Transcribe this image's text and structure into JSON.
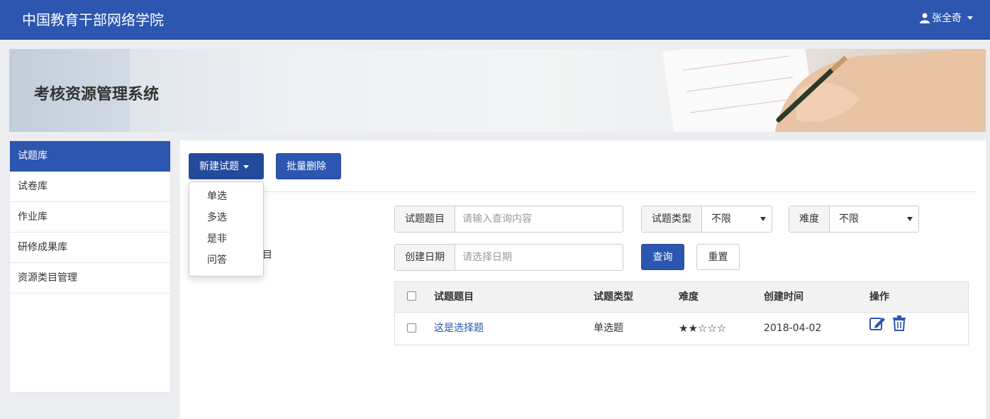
{
  "header": {
    "brand": "中国教育干部网络学院",
    "user_name": "张全奇"
  },
  "banner": {
    "title": "考核资源管理系统"
  },
  "sidebar": {
    "items": [
      {
        "label": "试题库",
        "active": true
      },
      {
        "label": "试卷库"
      },
      {
        "label": "作业库"
      },
      {
        "label": "研修成果库"
      },
      {
        "label": "资源类目管理"
      }
    ]
  },
  "toolbar": {
    "new_label": "新建试题",
    "batch_delete_label": "批量删除"
  },
  "new_menu": {
    "items": [
      "单选",
      "多选",
      "是非",
      "问答"
    ]
  },
  "partial_text": "目",
  "filters": {
    "title_label": "试题题目",
    "title_placeholder": "请输入查询内容",
    "type_label": "试题类型",
    "type_value": "不限",
    "difficulty_label": "难度",
    "difficulty_value": "不限",
    "date_label": "创建日期",
    "date_placeholder": "请选择日期",
    "query_label": "查询",
    "reset_label": "重置"
  },
  "table": {
    "headers": {
      "title": "试题题目",
      "type": "试题类型",
      "difficulty": "难度",
      "created": "创建时间",
      "ops": "操作"
    },
    "rows": [
      {
        "title": "这是选择题",
        "type": "单选题",
        "difficulty_stars": "★★☆☆☆",
        "difficulty_value": 2,
        "difficulty_max": 5,
        "created": "2018-04-02"
      }
    ]
  },
  "colors": {
    "primary": "#2d56b0",
    "link": "#2d56b0"
  }
}
